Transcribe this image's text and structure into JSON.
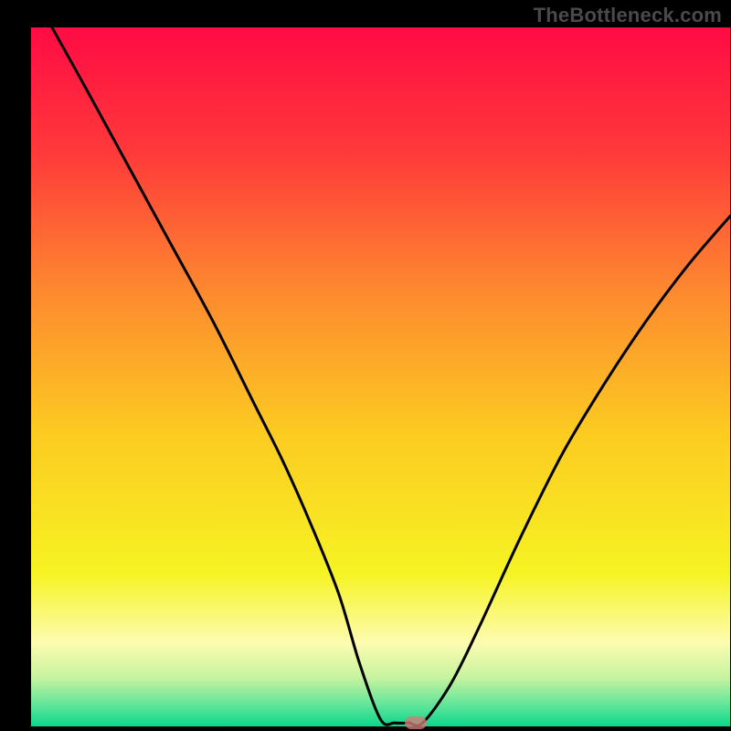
{
  "watermark": "TheBottleneck.com",
  "chart_data": {
    "type": "line",
    "title": "",
    "xlabel": "",
    "ylabel": "",
    "xlim": [
      0,
      100
    ],
    "ylim": [
      0,
      100
    ],
    "grid": false,
    "legend": false,
    "x": [
      3,
      8,
      14,
      20,
      26,
      32,
      36,
      40,
      44,
      47,
      50,
      52,
      54,
      56,
      60,
      64,
      70,
      76,
      82,
      88,
      94,
      100
    ],
    "y": [
      100,
      91,
      80,
      69,
      58,
      46,
      38,
      29,
      19,
      9,
      1,
      0.5,
      0.5,
      0.5,
      6,
      14,
      27,
      39,
      49,
      58,
      66,
      73
    ],
    "background_gradient_stops": [
      {
        "offset": 0.0,
        "color": "#ff0b44"
      },
      {
        "offset": 0.18,
        "color": "#ff3a3a"
      },
      {
        "offset": 0.38,
        "color": "#fd8a2f"
      },
      {
        "offset": 0.58,
        "color": "#fccb21"
      },
      {
        "offset": 0.78,
        "color": "#f6f323"
      },
      {
        "offset": 0.88,
        "color": "#fdfcb0"
      },
      {
        "offset": 0.93,
        "color": "#c7f3a0"
      },
      {
        "offset": 0.97,
        "color": "#5fe59a"
      },
      {
        "offset": 1.0,
        "color": "#0bd68b"
      }
    ],
    "marker": {
      "x": 55,
      "y": 0.5,
      "color": "#d47a78"
    }
  }
}
